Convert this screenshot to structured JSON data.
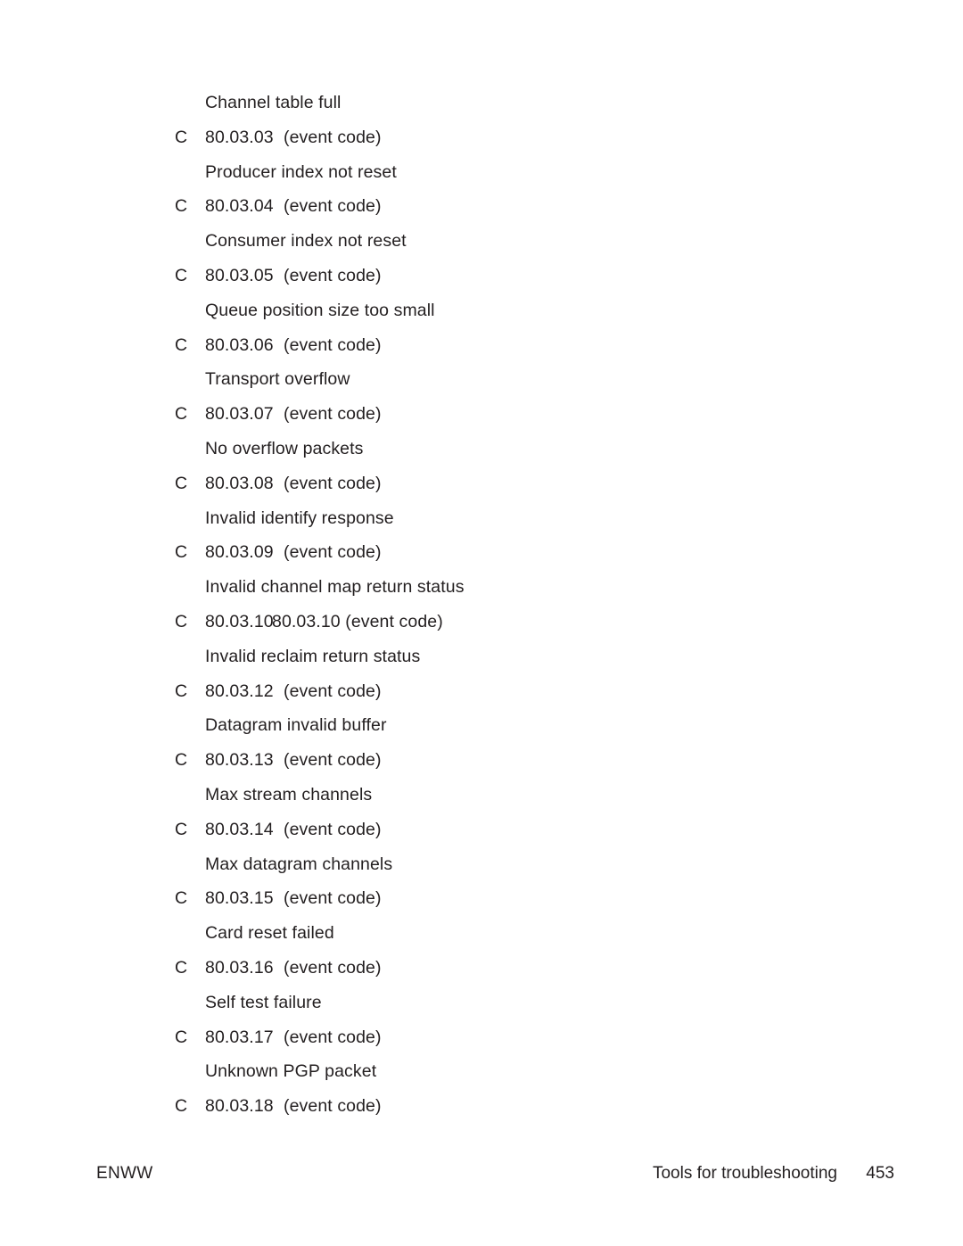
{
  "page": {
    "background": "#ffffff",
    "text_color": "#231f20"
  },
  "entries": [
    {
      "description": "Channel table full",
      "marker": "C",
      "code": "80.03.03",
      "note": "(event code)"
    },
    {
      "description": "Producer index not reset",
      "marker": "C",
      "code": "80.03.04",
      "note": "(event code)"
    },
    {
      "description": "Consumer index not reset",
      "marker": "C",
      "code": "80.03.05",
      "note": "(event code)"
    },
    {
      "description": "Queue position size too small",
      "marker": "C",
      "code": "80.03.06",
      "note": "(event code)"
    },
    {
      "description": "Transport overflow",
      "marker": "C",
      "code": "80.03.07",
      "note": "(event code)"
    },
    {
      "description": "No overflow packets",
      "marker": "C",
      "code": "80.03.08",
      "note": "(event code)"
    },
    {
      "description": "Invalid identify response",
      "marker": "C",
      "code": "80.03.09",
      "note": "(event code)"
    },
    {
      "description": "Invalid channel map return status",
      "marker": "C",
      "code": "80.03.10",
      "note": "80.03.10 (event code)"
    },
    {
      "description": "Invalid reclaim return status",
      "marker": "C",
      "code": "80.03.12",
      "note": "(event code)"
    },
    {
      "description": "Datagram invalid buffer",
      "marker": "C",
      "code": "80.03.13",
      "note": "(event code)"
    },
    {
      "description": "Max stream channels",
      "marker": "C",
      "code": "80.03.14",
      "note": "(event code)"
    },
    {
      "description": "Max datagram channels",
      "marker": "C",
      "code": "80.03.15",
      "note": "(event code)"
    },
    {
      "description": "Card reset failed",
      "marker": "C",
      "code": "80.03.16",
      "note": "(event code)"
    },
    {
      "description": "Self test failure",
      "marker": "C",
      "code": "80.03.17",
      "note": "(event code)"
    },
    {
      "description": "Unknown PGP packet",
      "marker": "C",
      "code": "80.03.18",
      "note": "(event code)"
    }
  ],
  "footer": {
    "left": "ENWW",
    "chapter": "Tools for troubleshooting",
    "page_number": "453"
  }
}
